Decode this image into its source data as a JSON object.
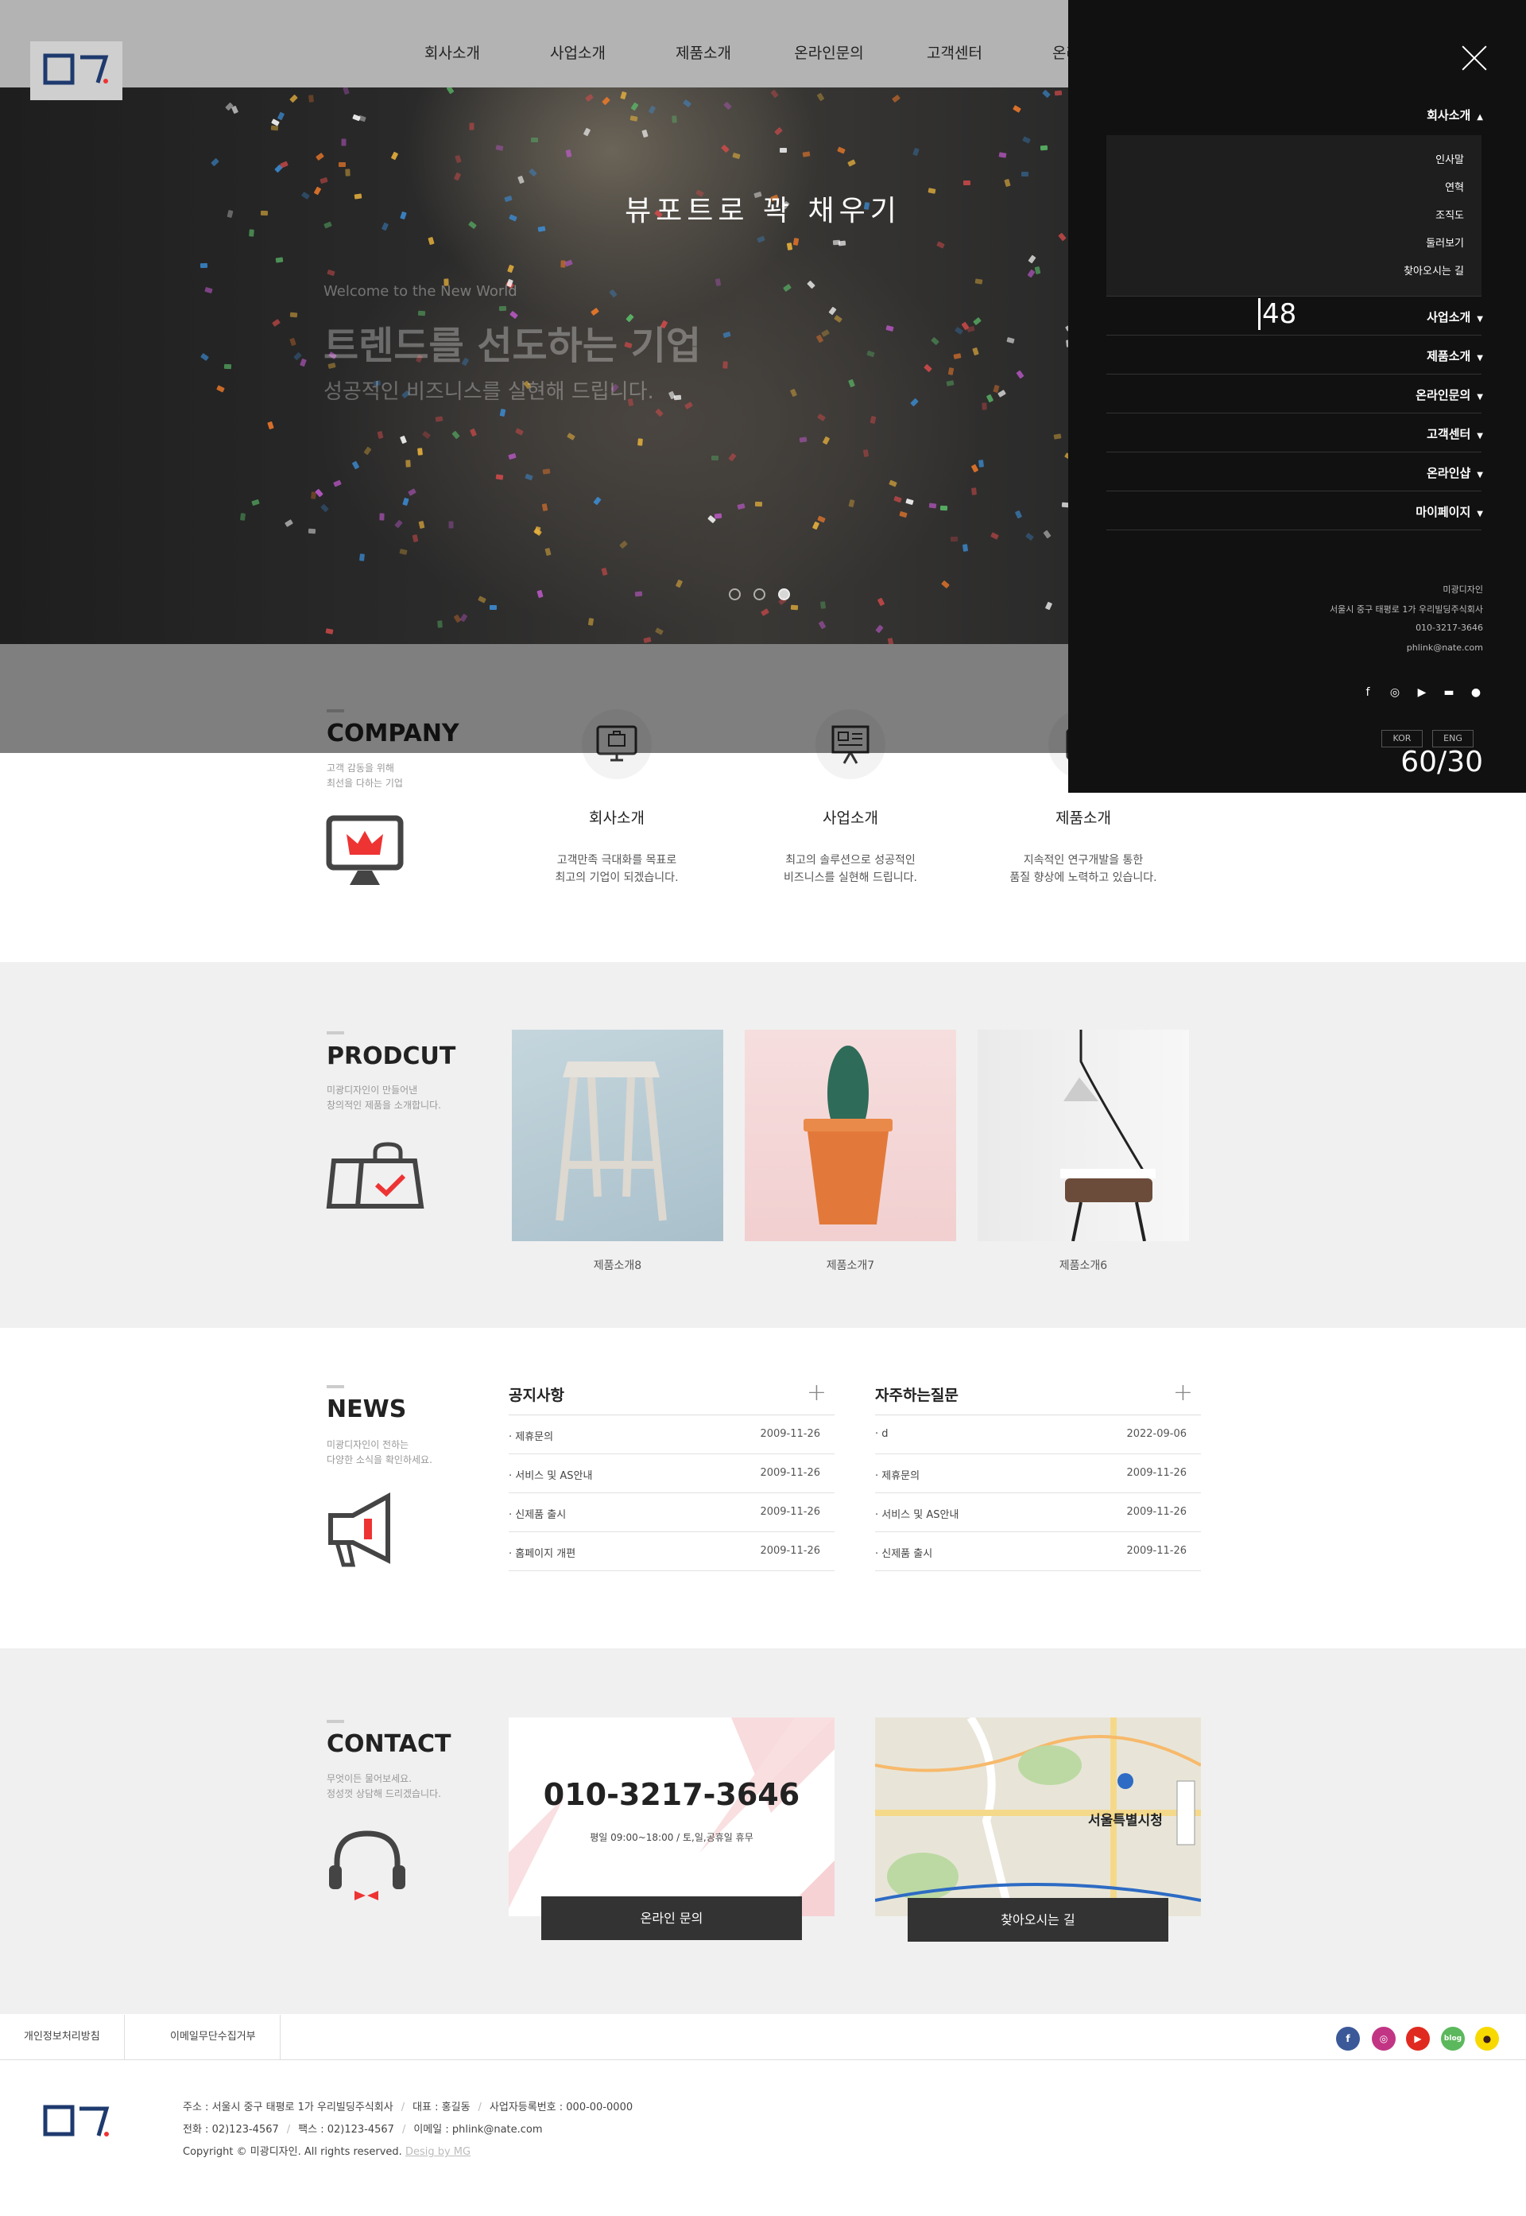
{
  "header": {
    "nav": [
      "회사소개",
      "사업소개",
      "제품소개",
      "온라인문의",
      "고객센터",
      "온라인샵"
    ]
  },
  "hero": {
    "banner": "뷰포트로 꽉 채우기",
    "tag": "Welcome to the New World",
    "title": "트렌드를 선도하는 기업",
    "sub": "성공적인 비즈니스를 실현해 드립니다."
  },
  "panel": {
    "menu": [
      "회사소개",
      "사업소개",
      "제품소개",
      "온라인문의",
      "고객센터",
      "온라인샵",
      "마이페이지"
    ],
    "submenu": [
      "인사말",
      "연혁",
      "조직도",
      "둘러보기",
      "찾아오시는 길"
    ],
    "counter": "48",
    "info": [
      "미광디자인",
      "서울시 중구 태평로 1가 우리빌딩주식회사",
      "010-3217-3646",
      "phlink@nate.com"
    ],
    "social_icons": [
      "facebook-icon",
      "instagram-icon",
      "youtube-icon",
      "blog-icon",
      "kakao-icon"
    ],
    "lang": [
      "KOR",
      "ENG"
    ],
    "page_current": "60",
    "page_total": "30"
  },
  "company": {
    "title": "COMPANY",
    "desc": [
      "고객 감동을 위해",
      "최선을 다하는 기업"
    ],
    "cards": [
      {
        "name": "회사소개",
        "desc": [
          "고객만족 극대화를 목표로",
          "최고의 기업이 되겠습니다."
        ]
      },
      {
        "name": "사업소개",
        "desc": [
          "최고의 솔루션으로 성공적인",
          "비즈니스를 실현해 드립니다."
        ]
      },
      {
        "name": "제품소개",
        "desc": [
          "지속적인 연구개발을 통한",
          "품질 향상에 노력하고 있습니다."
        ]
      }
    ]
  },
  "product": {
    "title": "PRODCUT",
    "desc": [
      "미광디자인이 만들어낸",
      "창의적인 제품을 소개합니다."
    ],
    "items": [
      "제품소개8",
      "제품소개7",
      "제품소개6"
    ]
  },
  "news": {
    "title": "NEWS",
    "desc": [
      "미광디자인이 전하는",
      "다양한 소식을 확인하세요."
    ],
    "notice": {
      "title": "공지사항",
      "rows": [
        {
          "t": "· 제휴문의",
          "d": "2009-11-26"
        },
        {
          "t": "· 서비스 및 AS안내",
          "d": "2009-11-26"
        },
        {
          "t": "· 신제품 출시",
          "d": "2009-11-26"
        },
        {
          "t": "· 홈페이지 개편",
          "d": "2009-11-26"
        }
      ]
    },
    "faq": {
      "title": "자주하는질문",
      "rows": [
        {
          "t": "· d",
          "d": "2022-09-06"
        },
        {
          "t": "· 제휴문의",
          "d": "2009-11-26"
        },
        {
          "t": "· 서비스 및 AS안내",
          "d": "2009-11-26"
        },
        {
          "t": "· 신제품 출시",
          "d": "2009-11-26"
        }
      ]
    }
  },
  "contact": {
    "title": "CONTACT",
    "desc": [
      "무엇이든 물어보세요.",
      "정성껏 상담해 드리겠습니다."
    ],
    "phone": "010-3217-3646",
    "hours": "평일 09:00~18:00 / 토,일,공휴일 휴무",
    "btn_inquiry": "온라인 문의",
    "btn_map": "찾아오시는 길",
    "map_label": "서울특별시청"
  },
  "footer": {
    "links": [
      "개인정보처리방침",
      "이메일무단수집거부"
    ],
    "address": "주소 : 서울시 중구 태평로 1가 우리빌딩주식회사",
    "ceo": "대표 : 홍길동",
    "bizno": "사업자등록번호 : 000-00-0000",
    "tel": "전화 : 02)123-4567",
    "fax": "팩스 : 02)123-4567",
    "email": "이메일 : phlink@nate.com",
    "copyright": "Copyright © 미광디자인. All rights reserved.",
    "design": "Desig by MG",
    "social": [
      {
        "icon": "facebook-icon",
        "color": "#3b5998",
        "glyph": "f"
      },
      {
        "icon": "instagram-icon",
        "color": "#c13584",
        "glyph": "◎"
      },
      {
        "icon": "youtube-icon",
        "color": "#e02a20",
        "glyph": "▶"
      },
      {
        "icon": "blog-icon",
        "color": "#5cb85c",
        "glyph": "blog"
      },
      {
        "icon": "kakao-icon",
        "color": "#f7d900",
        "glyph": "●"
      }
    ]
  }
}
